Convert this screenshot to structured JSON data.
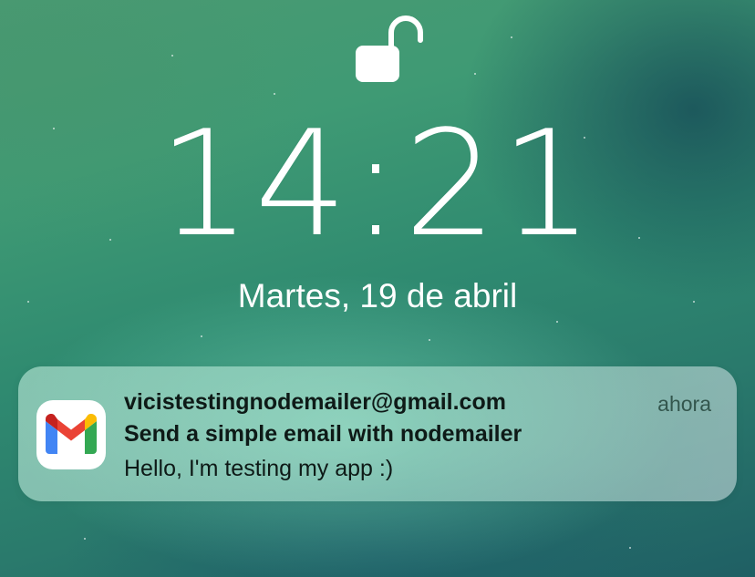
{
  "lock_screen": {
    "lock_icon": "unlocked-padlock-icon",
    "time": "14:21",
    "date": "Martes, 19 de abril"
  },
  "notification": {
    "app_icon": "gmail-icon",
    "sender": "vicistestingnodemailer@gmail.com",
    "timestamp": "ahora",
    "subject": "Send a simple email with nodemailer",
    "body": "Hello, I'm testing my app :)"
  },
  "colors": {
    "wallpaper_green": "#3f9a74",
    "gmail_red": "#EA4335",
    "gmail_blue": "#4285F4",
    "gmail_green": "#34A853",
    "gmail_yellow": "#FBBC04",
    "gmail_dark_red": "#C5221F"
  }
}
